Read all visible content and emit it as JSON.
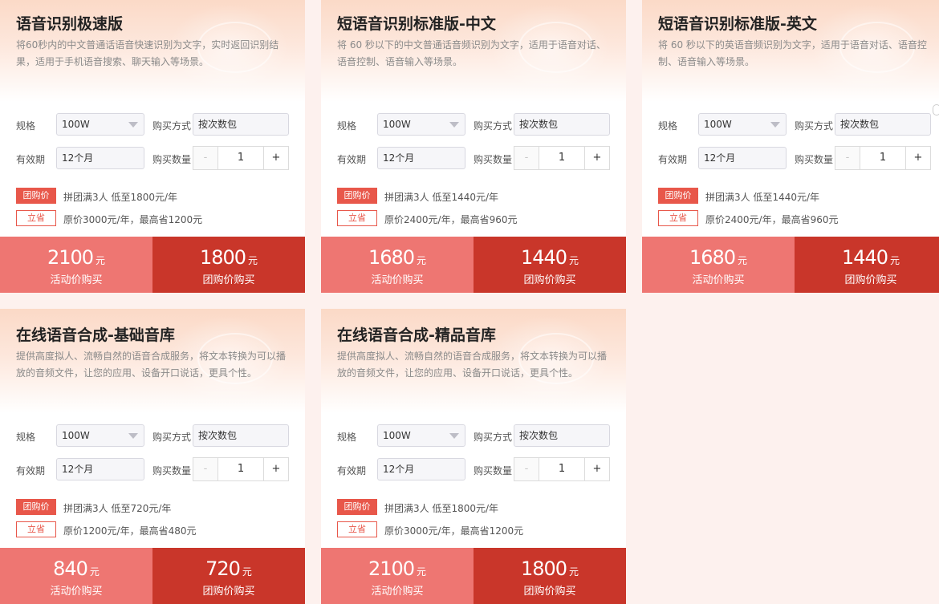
{
  "labels": {
    "spec": "规格",
    "validity": "有效期",
    "buy_method": "购买方式",
    "buy_qty": "购买数量",
    "group_tag": "团购价",
    "save_tag": "立省",
    "currency": "元",
    "promo_btn": "活动价购买",
    "group_btn": "团购价购买",
    "minus": "-",
    "plus": "+"
  },
  "cards": [
    {
      "title": "语音识别极速版",
      "desc": "将60秒内的中文普通话语音快速识别为文字，实时返回识别结果，适用于手机语音搜索、聊天输入等场景。",
      "spec": "100W",
      "validity": "12个月",
      "method": "按次数包",
      "qty": "1",
      "group_info": "拼团满3人 低至1800元/年",
      "save_info": "原价3000元/年，最高省1200元",
      "promo_price": "2100",
      "group_price": "1800"
    },
    {
      "title": "短语音识别标准版-中文",
      "desc": "将 60 秒以下的中文普通话音频识别为文字，适用于语音对话、语音控制、语音输入等场景。",
      "spec": "100W",
      "validity": "12个月",
      "method": "按次数包",
      "qty": "1",
      "group_info": "拼团满3人 低至1440元/年",
      "save_info": "原价2400元/年，最高省960元",
      "promo_price": "1680",
      "group_price": "1440"
    },
    {
      "title": "短语音识别标准版-英文",
      "desc": "将 60 秒以下的英语音频识别为文字，适用于语音对话、语音控制、语音输入等场景。",
      "spec": "100W",
      "validity": "12个月",
      "method": "按次数包",
      "qty": "1",
      "group_info": "拼团满3人 低至1440元/年",
      "save_info": "原价2400元/年，最高省960元",
      "promo_price": "1680",
      "group_price": "1440"
    },
    {
      "title": "在线语音合成-基础音库",
      "desc": "提供高度拟人、流畅自然的语音合成服务，将文本转换为可以播放的音频文件，让您的应用、设备开口说话，更具个性。",
      "spec": "100W",
      "validity": "12个月",
      "method": "按次数包",
      "qty": "1",
      "group_info": "拼团满3人 低至720元/年",
      "save_info": "原价1200元/年，最高省480元",
      "promo_price": "840",
      "group_price": "720"
    },
    {
      "title": "在线语音合成-精品音库",
      "desc": "提供高度拟人、流畅自然的语音合成服务，将文本转换为可以播放的音频文件，让您的应用、设备开口说话，更具个性。",
      "spec": "100W",
      "validity": "12个月",
      "method": "按次数包",
      "qty": "1",
      "group_info": "拼团满3人 低至1800元/年",
      "save_info": "原价3000元/年，最高省1200元",
      "promo_price": "2100",
      "group_price": "1800"
    }
  ],
  "colors": {
    "page_bg": "#fdf1ee",
    "promo_button": "#ee7672",
    "group_button": "#c9362a",
    "tag_red": "#e8574a"
  }
}
